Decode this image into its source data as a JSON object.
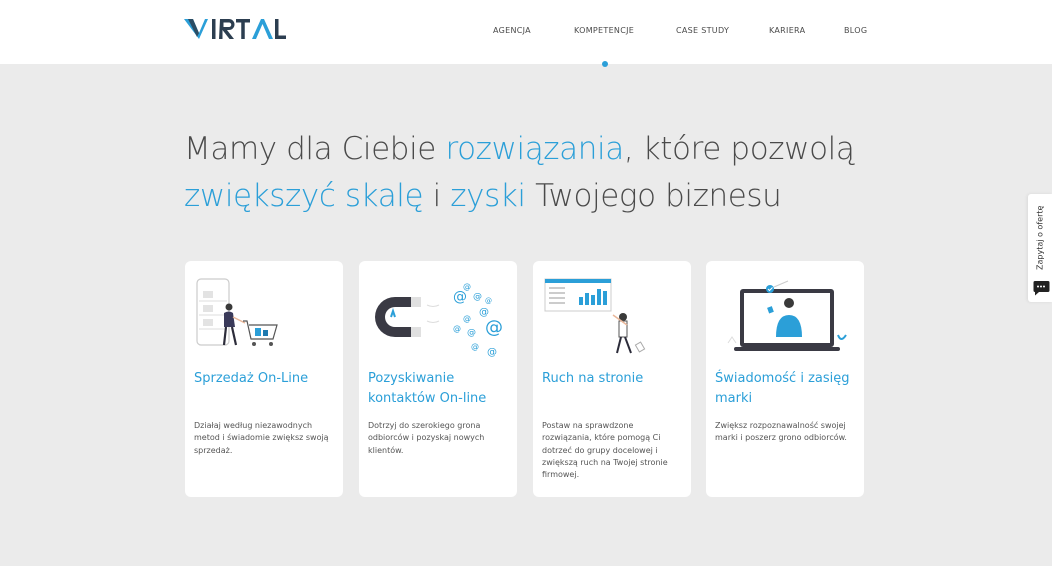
{
  "logo": {
    "text": "VIRTAL",
    "colors": {
      "primary": "#2b9fd8",
      "dark": "#2c3e50"
    }
  },
  "nav": {
    "items": [
      {
        "label": "AGENCJA"
      },
      {
        "label": "KOMPETENCJE"
      },
      {
        "label": "CASE STUDY"
      },
      {
        "label": "KARIERA"
      },
      {
        "label": "BLOG"
      }
    ],
    "active_index": 1
  },
  "hero": {
    "p1": "Mamy dla Ciebie ",
    "h1": "rozwiązania",
    "p2": ", które pozwolą ",
    "h2": "zwiększyć skalę",
    "p3": " i ",
    "h3": "zyski",
    "p4": " Twojego biznesu"
  },
  "cards": [
    {
      "title": "Sprzedaż On-Line",
      "desc": "Działaj według niezawodnych metod i świadomie zwiększ swoją sprzedaż.",
      "icon": "shopping-cart-illustration"
    },
    {
      "title": "Pozyskiwanie kontaktów On-line",
      "desc": "Dotrzyj do szerokiego grona odbiorców i pozyskaj nowych klientów.",
      "icon": "magnet-email-illustration"
    },
    {
      "title": "Ruch na stronie",
      "desc": "Postaw na sprawdzone rozwiązania, które pomogą Ci dotrzeć do grupy docelowej i zwiększą ruch na Twojej stronie firmowej.",
      "icon": "analytics-chart-illustration"
    },
    {
      "title": "Świadomość i zasięg marki",
      "desc": "Zwiększ rozpoznawalność swojej marki i poszerz grono odbiorców.",
      "icon": "laptop-person-illustration"
    }
  ],
  "side_tab": {
    "label": "Zapytaj o ofertę",
    "icon": "chat-bubble-icon"
  },
  "colors": {
    "accent": "#2b9fd8",
    "background": "#ebebeb",
    "text": "#4a4a4a"
  }
}
